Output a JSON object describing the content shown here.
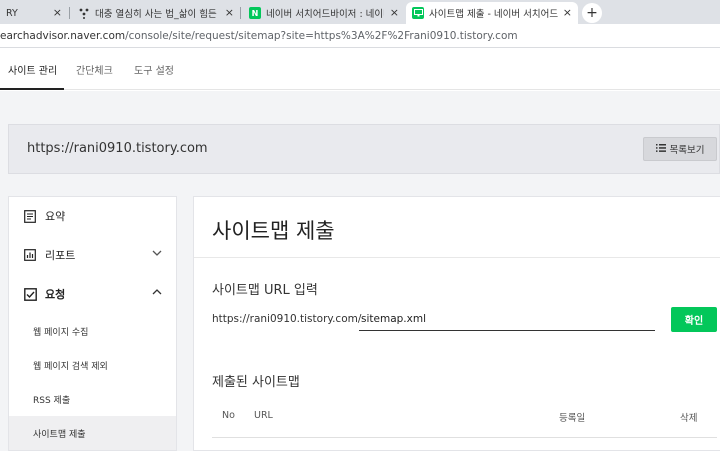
{
  "browser": {
    "tabs": [
      {
        "label": "RY",
        "favicon": ""
      },
      {
        "label": "대충 열심히 사는 법_삶이 힘든",
        "favicon": "dots"
      },
      {
        "label": "네이버 서치어드바이저 : 네이버",
        "favicon": "N"
      },
      {
        "label": "사이트맵 제출 - 네이버 서치어드",
        "favicon": "monitor"
      }
    ],
    "tab_close": "×",
    "new_tab": "+",
    "url": {
      "host": "earchadvisor.naver.com",
      "path": "/console/site/request/sitemap?site=https%3A%2F%2Frani0910.tistory.com"
    }
  },
  "nav": {
    "tabs": [
      "사이트 관리",
      "간단체크",
      "도구 설정"
    ],
    "active_index": 0
  },
  "site": {
    "url": "https://rani0910.tistory.com",
    "list_button": "목록보기"
  },
  "sidebar": {
    "items": [
      {
        "label": "요약",
        "icon": "document-icon"
      },
      {
        "label": "리포트",
        "icon": "chart-icon",
        "chevron": "down"
      },
      {
        "label": "요청",
        "icon": "checkbox-icon",
        "chevron": "up"
      }
    ],
    "subitems": [
      "웹 페이지 수집",
      "웹 페이지 검색 제외",
      "RSS 제출",
      "사이트맵 제출"
    ],
    "active_subitem": 3
  },
  "main": {
    "title": "사이트맵 제출",
    "input_section": "사이트맵 URL 입력",
    "prefix": "https://rani0910.tistory.com/",
    "input_value": "sitemap.xml",
    "confirm_button": "확인",
    "submitted_section": "제출된 사이트맵",
    "table_headers": {
      "no": "No",
      "url": "URL",
      "date": "등록일",
      "delete": "삭제"
    }
  },
  "colors": {
    "accent_green": "#03c75a",
    "tab_strip": "#dee1e6",
    "page_gray": "#f3f4f6"
  }
}
